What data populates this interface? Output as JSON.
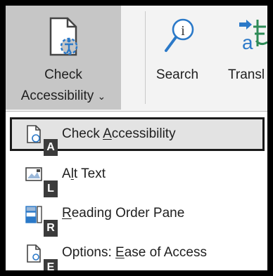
{
  "ribbon": {
    "check_accessibility": {
      "line1": "Check",
      "line2": "Accessibility",
      "chevron": "⌄"
    },
    "search": {
      "label": "Search"
    },
    "translate": {
      "label": "Transl"
    }
  },
  "menu": {
    "items": [
      {
        "pre": "Check ",
        "access": "A",
        "post": "ccessibility",
        "keytip": "A",
        "icon": "check-accessibility-icon"
      },
      {
        "pre": "A",
        "access": "l",
        "post": "t Text",
        "keytip": "L",
        "icon": "alt-text-icon"
      },
      {
        "pre": "",
        "access": "R",
        "post": "eading Order Pane",
        "keytip": "R",
        "icon": "reading-order-pane-icon"
      },
      {
        "pre": "Options: ",
        "access": "E",
        "post": "ase of Access",
        "keytip": "E",
        "icon": "options-ease-of-access-icon"
      }
    ]
  },
  "colors": {
    "ribbon_bg": "#f3f3f3",
    "pressed_button_bg": "#c6c6c6",
    "menu_bg": "#ffffff",
    "selected_bg": "#e3e3e3",
    "keytip_bg": "#3b3b3b",
    "accent_blue": "#2b79c8",
    "translate_green": "#2e8b57"
  }
}
